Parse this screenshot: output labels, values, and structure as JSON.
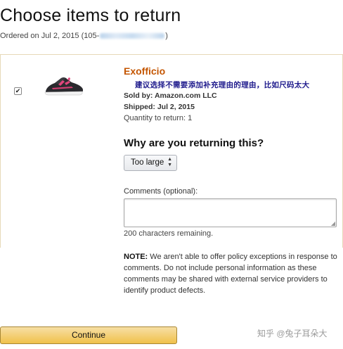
{
  "header": {
    "title": "Choose items to return",
    "ordered_prefix": "Ordered on Jul 2, 2015 (105-",
    "ordered_suffix": ")"
  },
  "item": {
    "checked": "✔",
    "title": "Exofficio",
    "annotation": "建议选择不需要添加补充理由的理由，比如尺码太大",
    "sold_by": "Sold by: Amazon.com LLC",
    "shipped": "Shipped: Jul 2, 2015",
    "quantity": "Quantity to return: 1",
    "image_icon": "shoe-image"
  },
  "form": {
    "heading": "Why are you returning this?",
    "reason_selected": "Too large",
    "comments_label": "Comments (optional):",
    "comments_value": "",
    "remaining": "200 characters remaining.",
    "note_label": "NOTE:",
    "note_text": "We aren't able to offer policy exceptions in response to comments. Do not include personal information as these comments may be shared with external service providers to identify product defects."
  },
  "footer": {
    "continue_label": "Continue",
    "watermark": "知乎 @兔子耳朵大"
  },
  "colors": {
    "product_title": "#c45500",
    "annotation": "#1e1a8c",
    "button_top": "#f7dfa5",
    "button_bottom": "#f0c14b"
  }
}
